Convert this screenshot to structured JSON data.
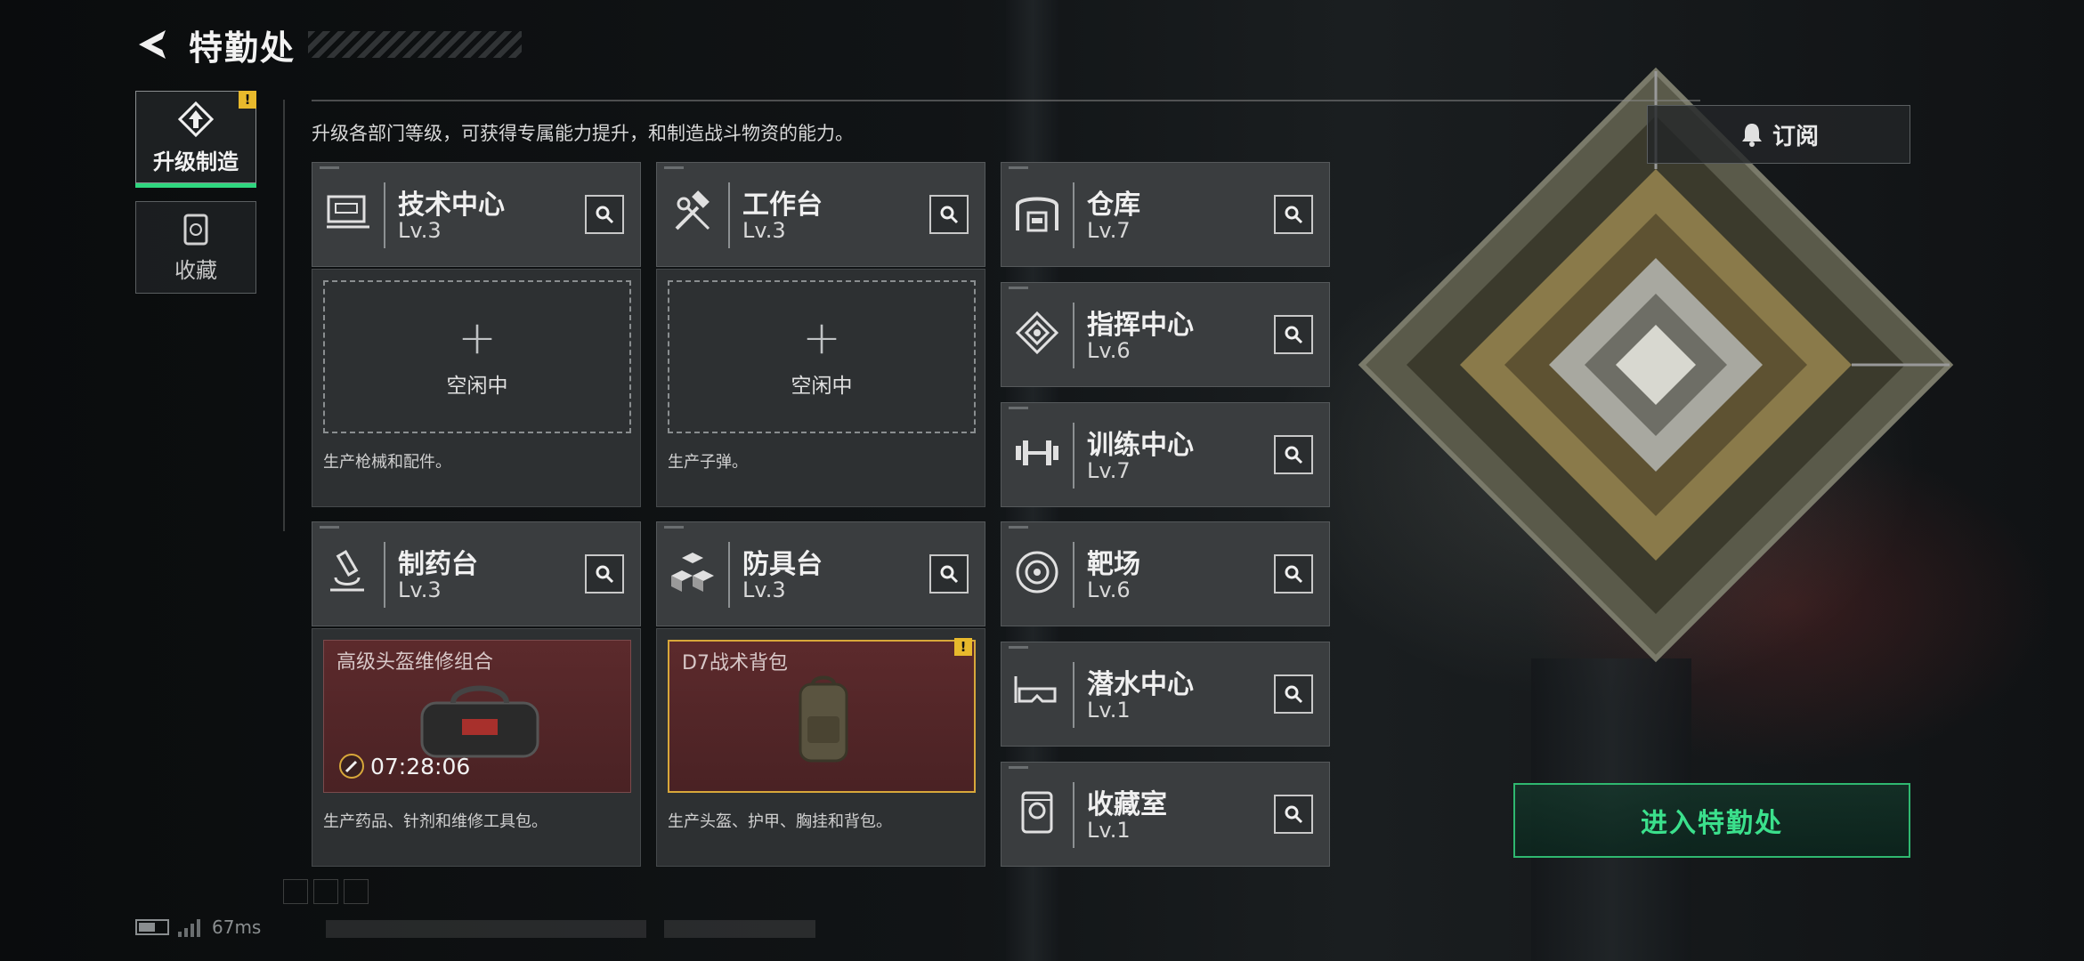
{
  "header": {
    "title": "特勤处"
  },
  "nav": {
    "items": [
      {
        "label": "升级制造",
        "active": true,
        "icon": "upgrade-icon"
      },
      {
        "label": "收藏",
        "active": false,
        "icon": "collection-icon"
      }
    ],
    "warning_mark": "!"
  },
  "description": "升级各部门等级，可获得专属能力提升，和制造战斗物资的能力。",
  "subscribe": {
    "label": "订阅",
    "icon": "bell-icon"
  },
  "departments": {
    "tech": {
      "name": "技术中心",
      "level": "Lv.3",
      "icon": "workstation-icon"
    },
    "workbench": {
      "name": "工作台",
      "level": "Lv.3",
      "icon": "tools-icon"
    },
    "pharmacy": {
      "name": "制药台",
      "level": "Lv.3",
      "icon": "microscope-icon"
    },
    "armor": {
      "name": "防具台",
      "level": "Lv.3",
      "icon": "cubes-icon"
    },
    "warehouse": {
      "name": "仓库",
      "level": "Lv.7",
      "icon": "warehouse-icon"
    },
    "command": {
      "name": "指挥中心",
      "level": "Lv.6",
      "icon": "chip-icon"
    },
    "training": {
      "name": "训练中心",
      "level": "Lv.7",
      "icon": "dumbbell-icon"
    },
    "range": {
      "name": "靶场",
      "level": "Lv.6",
      "icon": "target-icon"
    },
    "diving": {
      "name": "潜水中心",
      "level": "Lv.1",
      "icon": "goggles-icon"
    },
    "collection": {
      "name": "收藏室",
      "level": "Lv.1",
      "icon": "trophy-icon"
    }
  },
  "production": {
    "tech": {
      "status": "空闲中",
      "description": "生产枪械和配件。"
    },
    "workbench": {
      "status": "空闲中",
      "description": "生产子弹。"
    },
    "pharmacy": {
      "item": "高级头盔维修组合",
      "timer": "07:28:06",
      "description": "生产药品、针剂和维修工具包。"
    },
    "armor": {
      "item": "D7战术背包",
      "warning": "!",
      "description": "生产头盔、护甲、胸挂和背包。"
    }
  },
  "enter_button": {
    "label": "进入特勤处"
  },
  "status_bar": {
    "ping": "67ms",
    "battery_level": 0.6
  },
  "colors": {
    "accent": "#2fd67f",
    "warning": "#e8b92c",
    "item_bg": "#5c2a2c"
  }
}
